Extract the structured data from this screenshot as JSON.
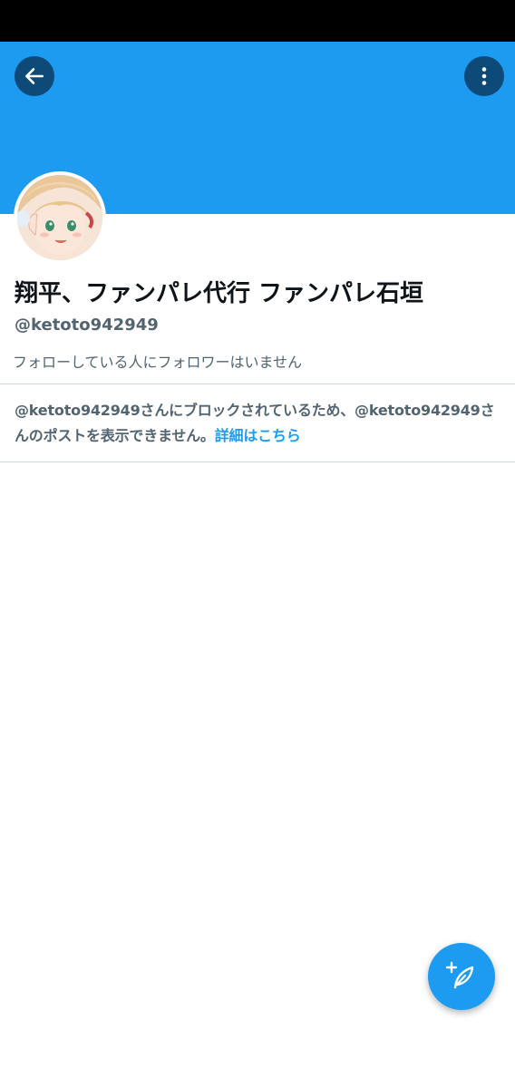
{
  "colors": {
    "banner": "#1d9bf0",
    "accent": "#1d9bf0",
    "secondary_text": "#536471",
    "icon_button_bg": "#0d4a78"
  },
  "header": {
    "back_icon": "arrow-left-icon",
    "more_icon": "more-vertical-icon"
  },
  "profile": {
    "display_name": "翔平、ファンパレ代行 ファンパレ石垣",
    "handle": "@ketoto942949",
    "followers_you_follow": "フォローしている人にフォロワーはいません"
  },
  "blocked_notice": {
    "text": "@ketoto942949さんにブロックされているため、@ketoto942949さんのポストを表示できません。",
    "link_label": "詳細はこちら"
  },
  "fab": {
    "icon": "compose-feather-icon"
  }
}
